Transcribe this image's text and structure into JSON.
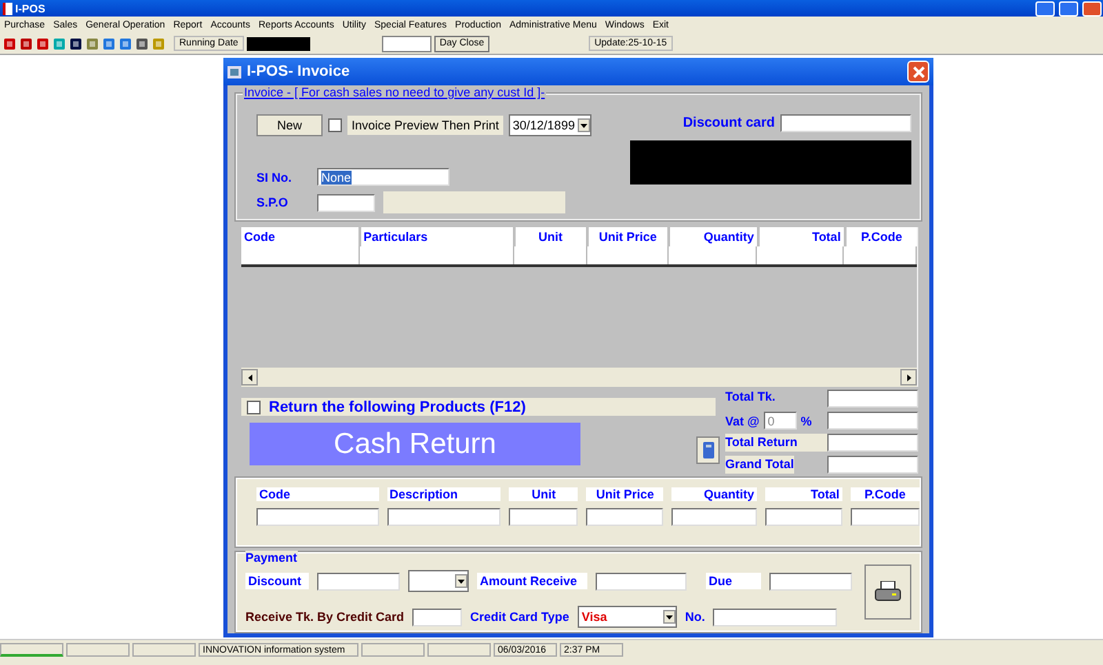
{
  "app": {
    "title": "I-POS"
  },
  "menu": [
    "Purchase",
    "Sales",
    "General Operation",
    "Report",
    "Accounts",
    "Reports Accounts",
    "Utility",
    "Special Features",
    "Production",
    "Administrative Menu",
    "Windows",
    "Exit"
  ],
  "toolbar": {
    "running_date_label": "Running Date",
    "day_close": "Day Close",
    "update": "Update:25-10-15"
  },
  "dialog": {
    "title": "I-POS- Invoice",
    "group_title": "Invoice - [ For cash sales no need to give any cust Id ]-",
    "new_button": "New",
    "preview": {
      "label": "Invoice Preview Then Print",
      "checked": false
    },
    "date": "30/12/1899",
    "discount_card_label": "Discount card",
    "si_label": "SI No.",
    "si_value": "None",
    "si_value_selected": true,
    "spo_label": "S.P.O"
  },
  "items_table": {
    "columns": [
      "Code",
      "Particulars",
      "Unit",
      "Unit Price",
      "Quantity",
      "Total",
      "P.Code"
    ]
  },
  "return": {
    "label": "Return the following Products (F12)",
    "checked": false,
    "cash_return": "Cash Return"
  },
  "totals": {
    "total_tk": "Total Tk.",
    "vat": "Vat @",
    "vat_value": "0",
    "percent": "%",
    "total_return": "Total Return",
    "grand_total": "Grand Total"
  },
  "return_table": {
    "columns": [
      "Code",
      "Description",
      "Unit",
      "Unit Price",
      "Quantity",
      "Total",
      "P.Code"
    ]
  },
  "payment": {
    "title": "Payment",
    "discount": "Discount",
    "amount_receive": "Amount Receive",
    "due": "Due",
    "credit_card": "Receive Tk. By Credit Card",
    "card_type_label": "Credit Card Type",
    "card_type": "Visa",
    "no": "No."
  },
  "status_bar": [
    "INNOVATION information system",
    "06/03/2016",
    "2:37 PM"
  ]
}
